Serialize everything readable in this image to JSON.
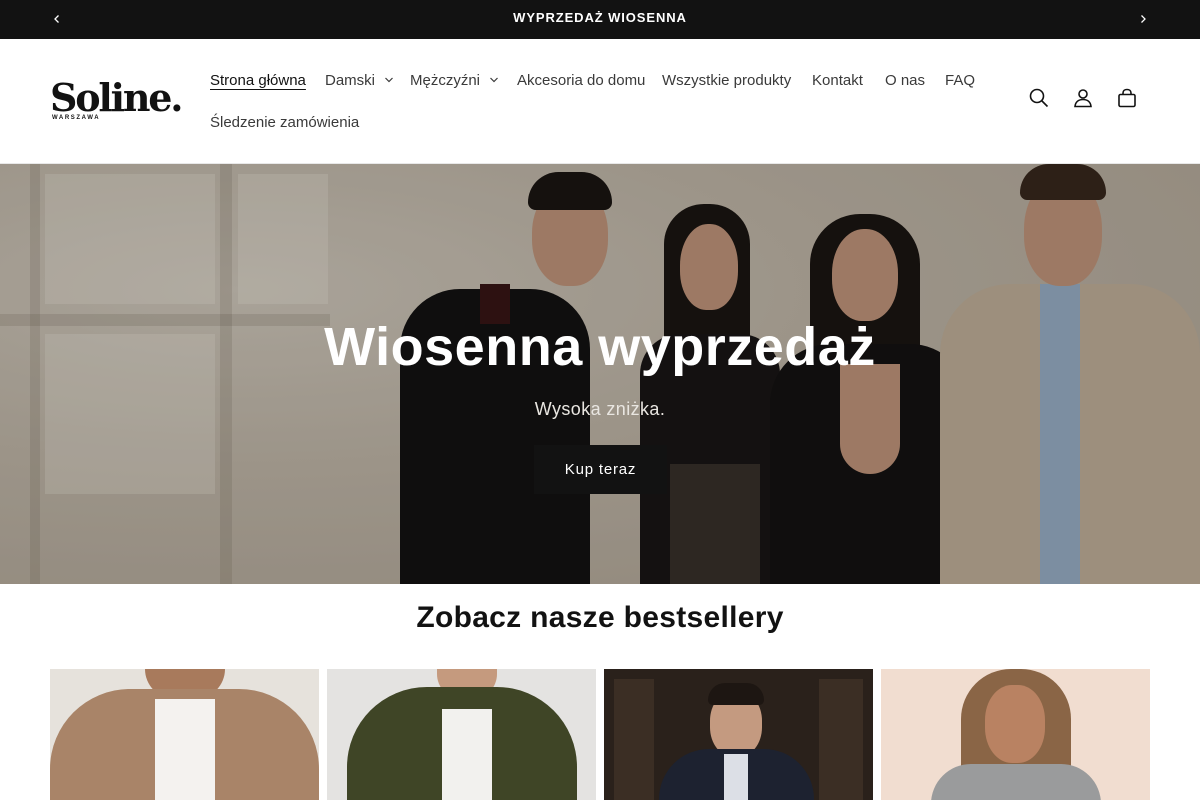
{
  "announcement": {
    "text": "WYPRZEDAŻ WIOSENNA",
    "prev_icon": "chevron-left-icon",
    "next_icon": "chevron-right-icon"
  },
  "header": {
    "logo_text": "Soline.",
    "logo_subtext": "WARSZAWA",
    "nav": [
      {
        "label": "Strona główna",
        "active": true,
        "dropdown": false
      },
      {
        "label": "Damski",
        "active": false,
        "dropdown": true
      },
      {
        "label": "Mężczyźni",
        "active": false,
        "dropdown": true
      },
      {
        "label": "Akcesoria do domu",
        "active": false,
        "dropdown": false
      },
      {
        "label": "Wszystkie produkty",
        "active": false,
        "dropdown": false
      },
      {
        "label": "Kontakt",
        "active": false,
        "dropdown": false
      },
      {
        "label": "O nas",
        "active": false,
        "dropdown": false
      },
      {
        "label": "FAQ",
        "active": false,
        "dropdown": false
      },
      {
        "label": "Śledzenie zamówienia",
        "active": false,
        "dropdown": false
      }
    ],
    "icons": [
      "search-icon",
      "account-icon",
      "cart-icon"
    ]
  },
  "hero": {
    "title": "Wiosenna wyprzedaż",
    "subtitle": "Wysoka zniżka.",
    "button_label": "Kup teraz"
  },
  "bestsellers": {
    "title": "Zobacz nasze bestsellery"
  },
  "colors": {
    "dark": "#121212",
    "white": "#ffffff",
    "nav_text": "#3a3a3a"
  }
}
